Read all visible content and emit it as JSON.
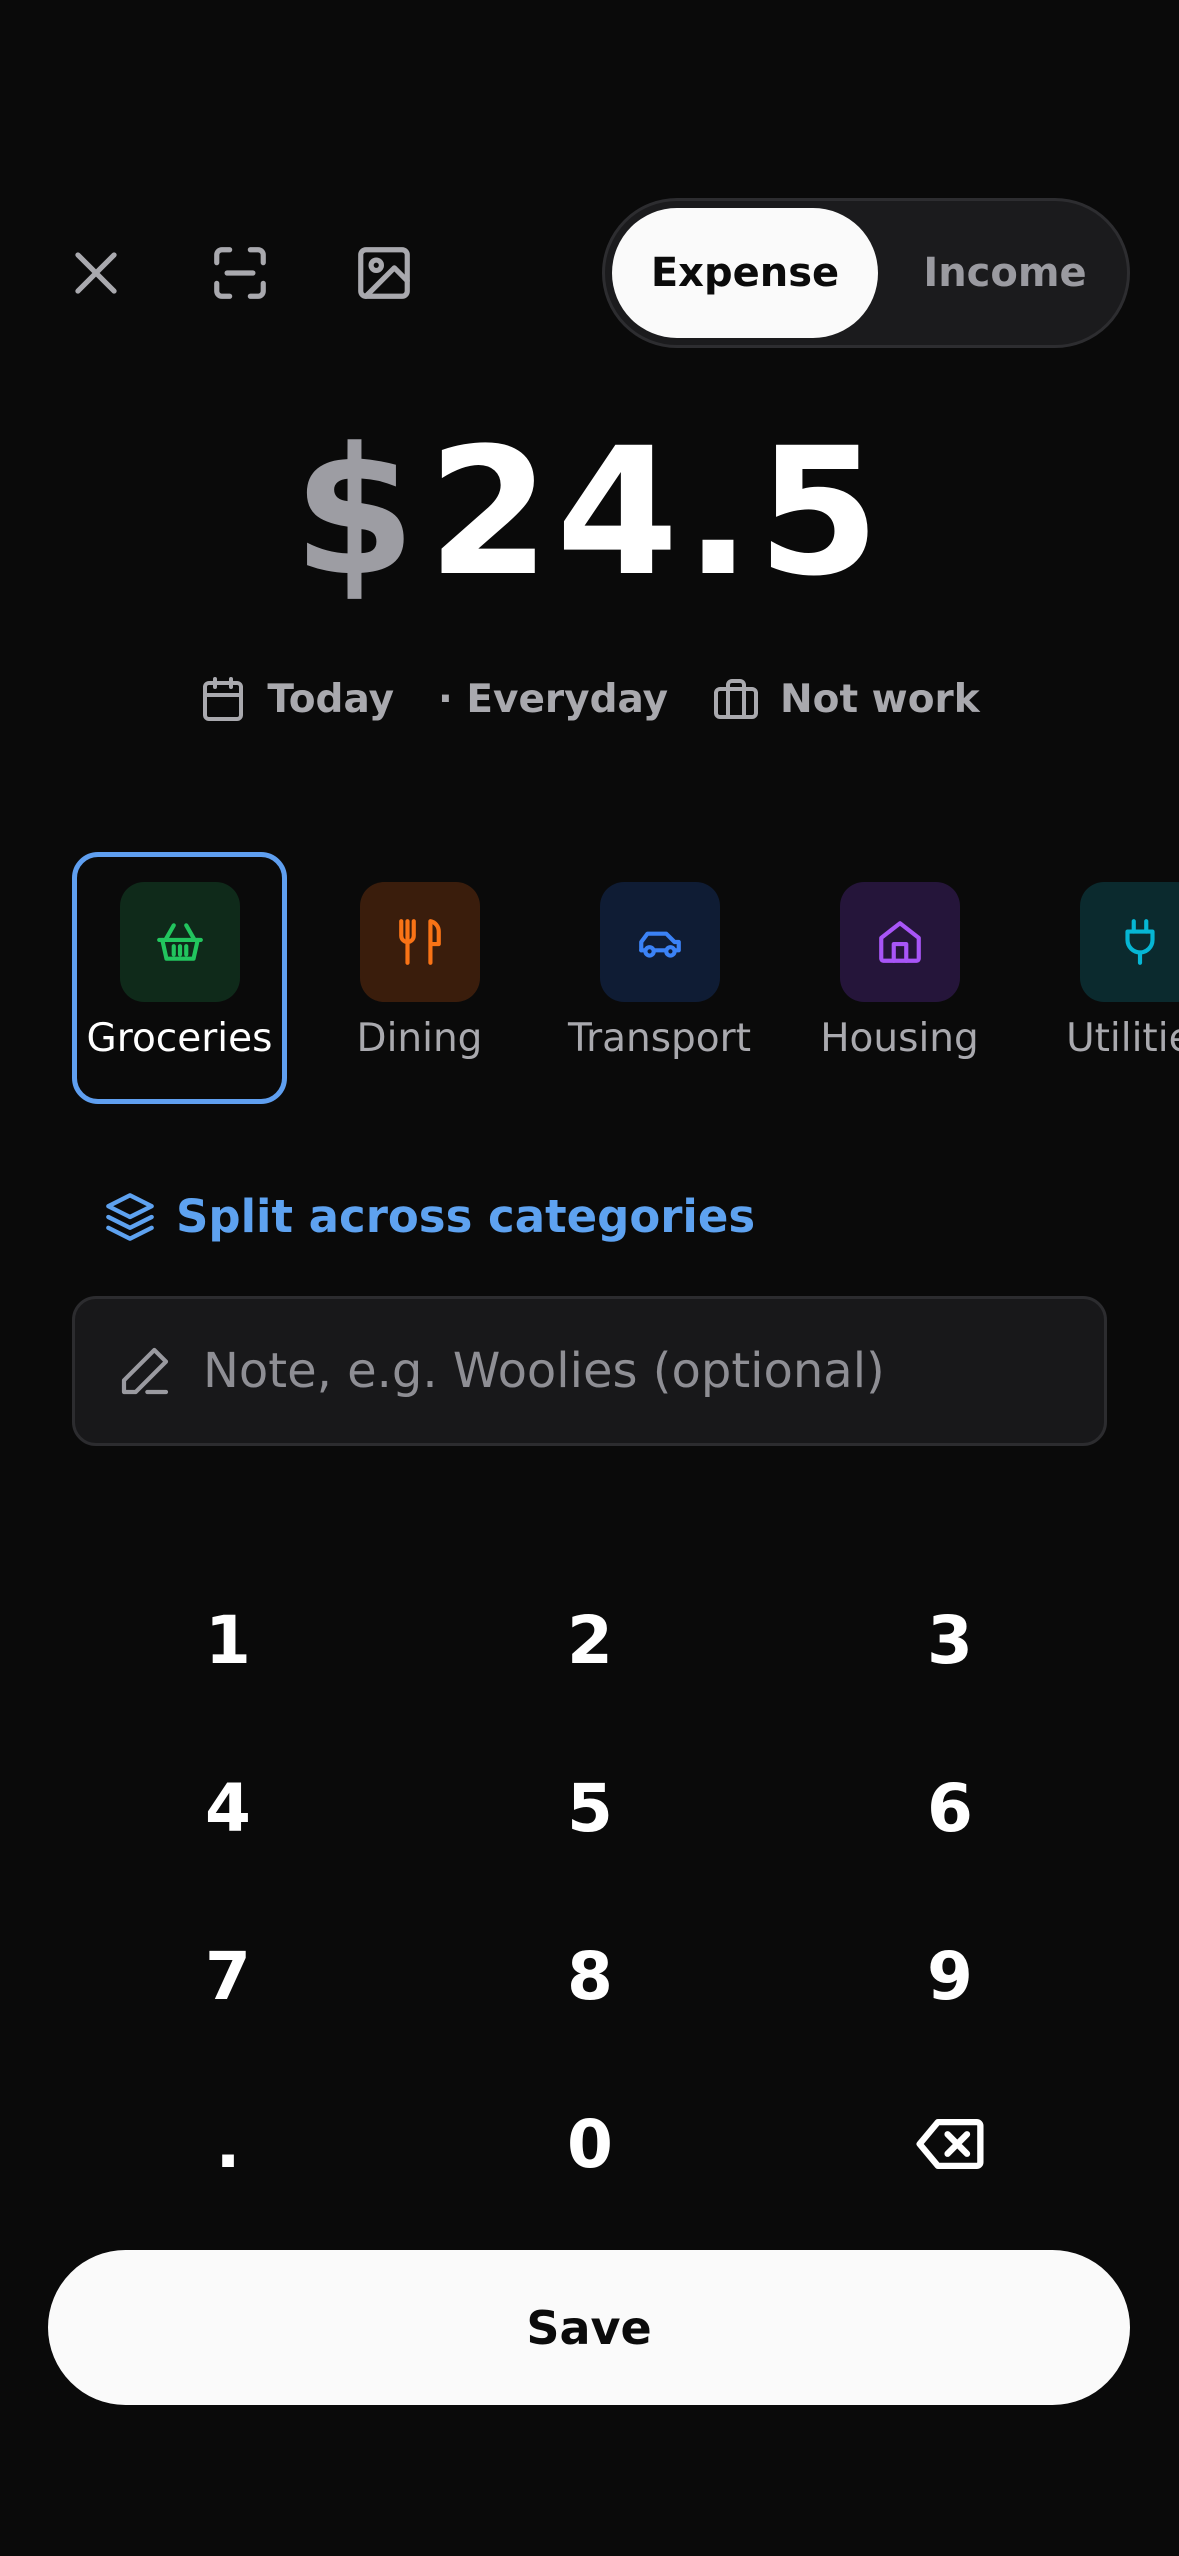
{
  "toolbar": {
    "close_icon": "close-icon",
    "scan_icon": "scan-icon",
    "image_icon": "image-icon"
  },
  "type_toggle": {
    "expense_label": "Expense",
    "income_label": "Income",
    "selected": "Expense"
  },
  "amount": {
    "currency": "$",
    "value": "24.5"
  },
  "meta": {
    "date_label": "Today",
    "tag_label": "· Everyday",
    "work_label": "Not work"
  },
  "categories": [
    {
      "label": "Groceries",
      "icon": "basket-icon",
      "color": "#22c55e",
      "bg": "#0f2a1a",
      "selected": true
    },
    {
      "label": "Dining",
      "icon": "utensils-icon",
      "color": "#f97316",
      "bg": "#3a1d0c",
      "selected": false
    },
    {
      "label": "Transport",
      "icon": "car-icon",
      "color": "#3b82f6",
      "bg": "#0f1c34",
      "selected": false
    },
    {
      "label": "Housing",
      "icon": "house-icon",
      "color": "#a855f7",
      "bg": "#25153a",
      "selected": false
    },
    {
      "label": "Utilities",
      "icon": "plug-icon",
      "color": "#06b6d4",
      "bg": "#0b2a2e",
      "selected": false
    }
  ],
  "split": {
    "label": "Split across categories"
  },
  "note": {
    "placeholder": "Note, e.g. Woolies (optional)",
    "value": ""
  },
  "keypad": {
    "keys": [
      "1",
      "2",
      "3",
      "4",
      "5",
      "6",
      "7",
      "8",
      "9",
      ".",
      "0"
    ],
    "backspace_icon": "backspace-icon"
  },
  "save": {
    "label": "Save"
  },
  "colors": {
    "background": "#0a0a0a",
    "accent": "#5ea2f0",
    "muted_text": "#a9a9ae"
  }
}
